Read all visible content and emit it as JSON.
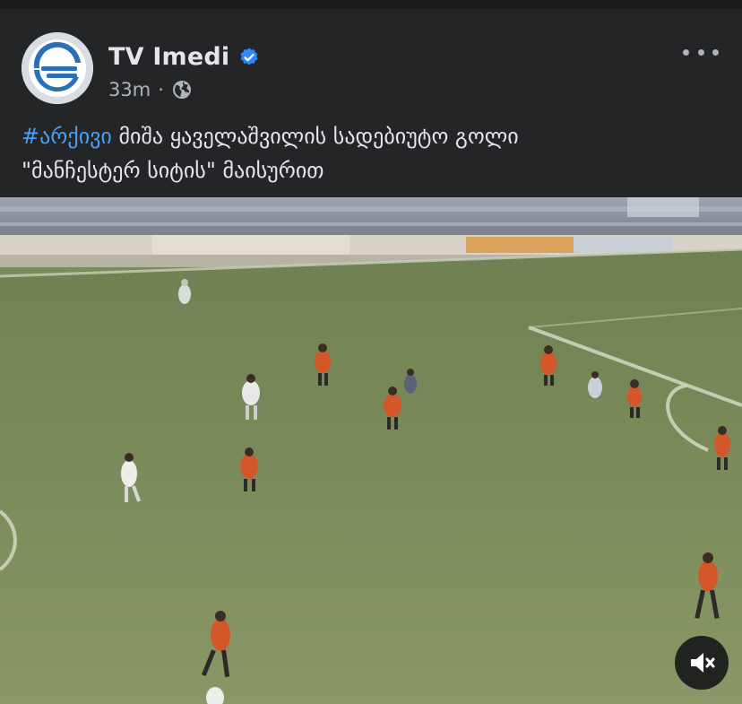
{
  "post": {
    "page_name": "TV Imedi",
    "verified_icon": "verified-badge-icon",
    "timestamp": "33m",
    "separator": "·",
    "audience_icon": "globe-icon",
    "more_icon": "more-options-icon",
    "caption": {
      "hashtag": "#არქივი",
      "line1_rest": " მიშა ყაველაშვილის სადებიუტო გოლი",
      "line2": "\"მანჩესტერ სიტის\" მაისურით"
    }
  },
  "video": {
    "mute_icon": "speaker-muted-icon"
  },
  "colors": {
    "background": "#242526",
    "hashtag": "#4a9ff5",
    "verified": "#2d88ff",
    "pitch": "#7b8c5c",
    "orange_kit": "#d4572a"
  }
}
